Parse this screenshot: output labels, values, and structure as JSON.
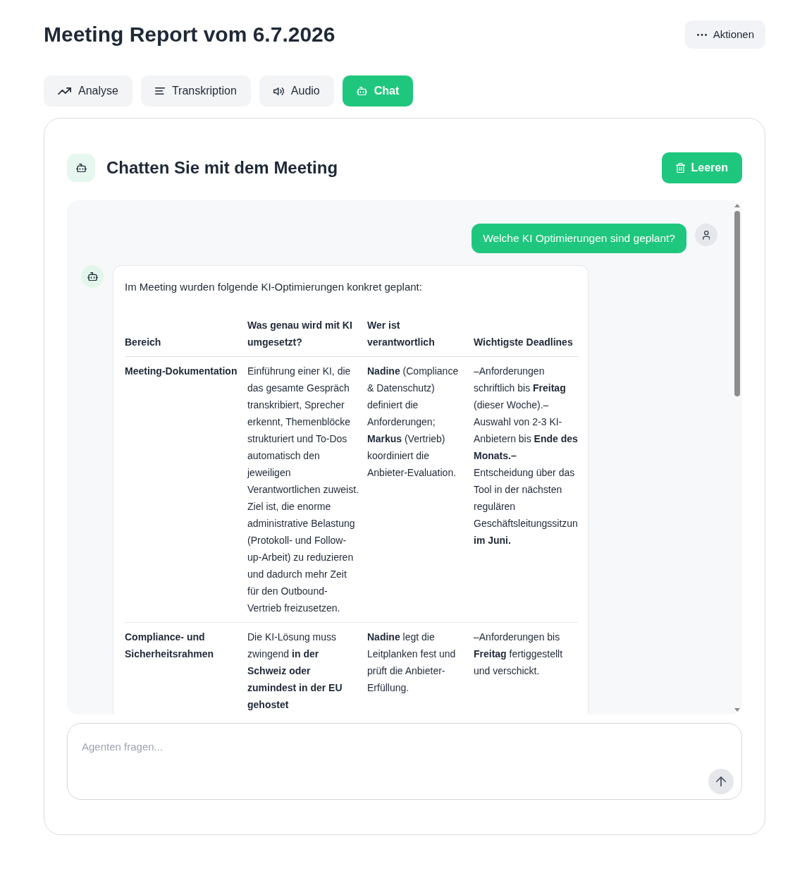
{
  "header": {
    "title": "Meeting Report vom 6.7.2026",
    "actions_button": "Aktionen"
  },
  "tabs": [
    {
      "kind": "analysis",
      "label": "Analyse",
      "selected": false
    },
    {
      "kind": "transcript",
      "label": "Transkription",
      "selected": false
    },
    {
      "kind": "audio",
      "label": "Audio",
      "selected": false
    },
    {
      "kind": "chat",
      "label": "Chat",
      "selected": true
    }
  ],
  "chat": {
    "title": "Chatten Sie mit dem Meeting",
    "clear_button": "Leeren",
    "messages": [
      {
        "kind": "user",
        "text": "Welche KI Optimierungen sind geplant?"
      },
      {
        "kind": "assistant",
        "text": "Im Meeting wurden folgende KI-Optimierungen konkret geplant:",
        "table": {
          "columns": [
            "Bereich",
            "Was genau wird mit KI umgesetzt?",
            "Wer ist verantwortlich",
            "Wichtigste Deadlines"
          ],
          "rows": [
            [
              "Meeting-Dokumentation",
              "Einführung einer KI, die das gesamte Gespräch transkribiert, Sprecher erkennt, Themenblöcke strukturiert und To-Dos automatisch den jeweiligen Verantwortlichen zuweist. Ziel ist, die enorme administrative Belastung (Protokoll- und Follow-up-Arbeit) zu reduzieren und dadurch mehr Zeit für den Outbound-Vertrieb freizusetzen.",
              "**Nadine** (Compliance & Datenschutz) definiert die Anforderungen; **Markus** (Vertrieb) koordiniert die Anbieter-Evaluation.",
              "–Anforderungen schriftlich bis **Freitag** (dieser Woche).– Auswahl von 2-3 KI-Anbietern bis **Ende des Monats.–** Entscheidung über das Tool in der nächsten regulären Geschäftsleitungssitzun **im Juni.**"
            ],
            [
              "Compliance- und Sicherheitsrahmen",
              "Die KI-Lösung muss zwingend **in der Schweiz oder zumindest in der EU gehostet**",
              "**Nadine** legt die Leitplanken fest und prüft die Anbieter-Erfüllung.",
              "–Anforderungen bis **Freitag** fertiggestellt und verschickt."
            ]
          ]
        }
      }
    ],
    "input": {
      "placeholder": "Agenten fragen..."
    }
  }
}
